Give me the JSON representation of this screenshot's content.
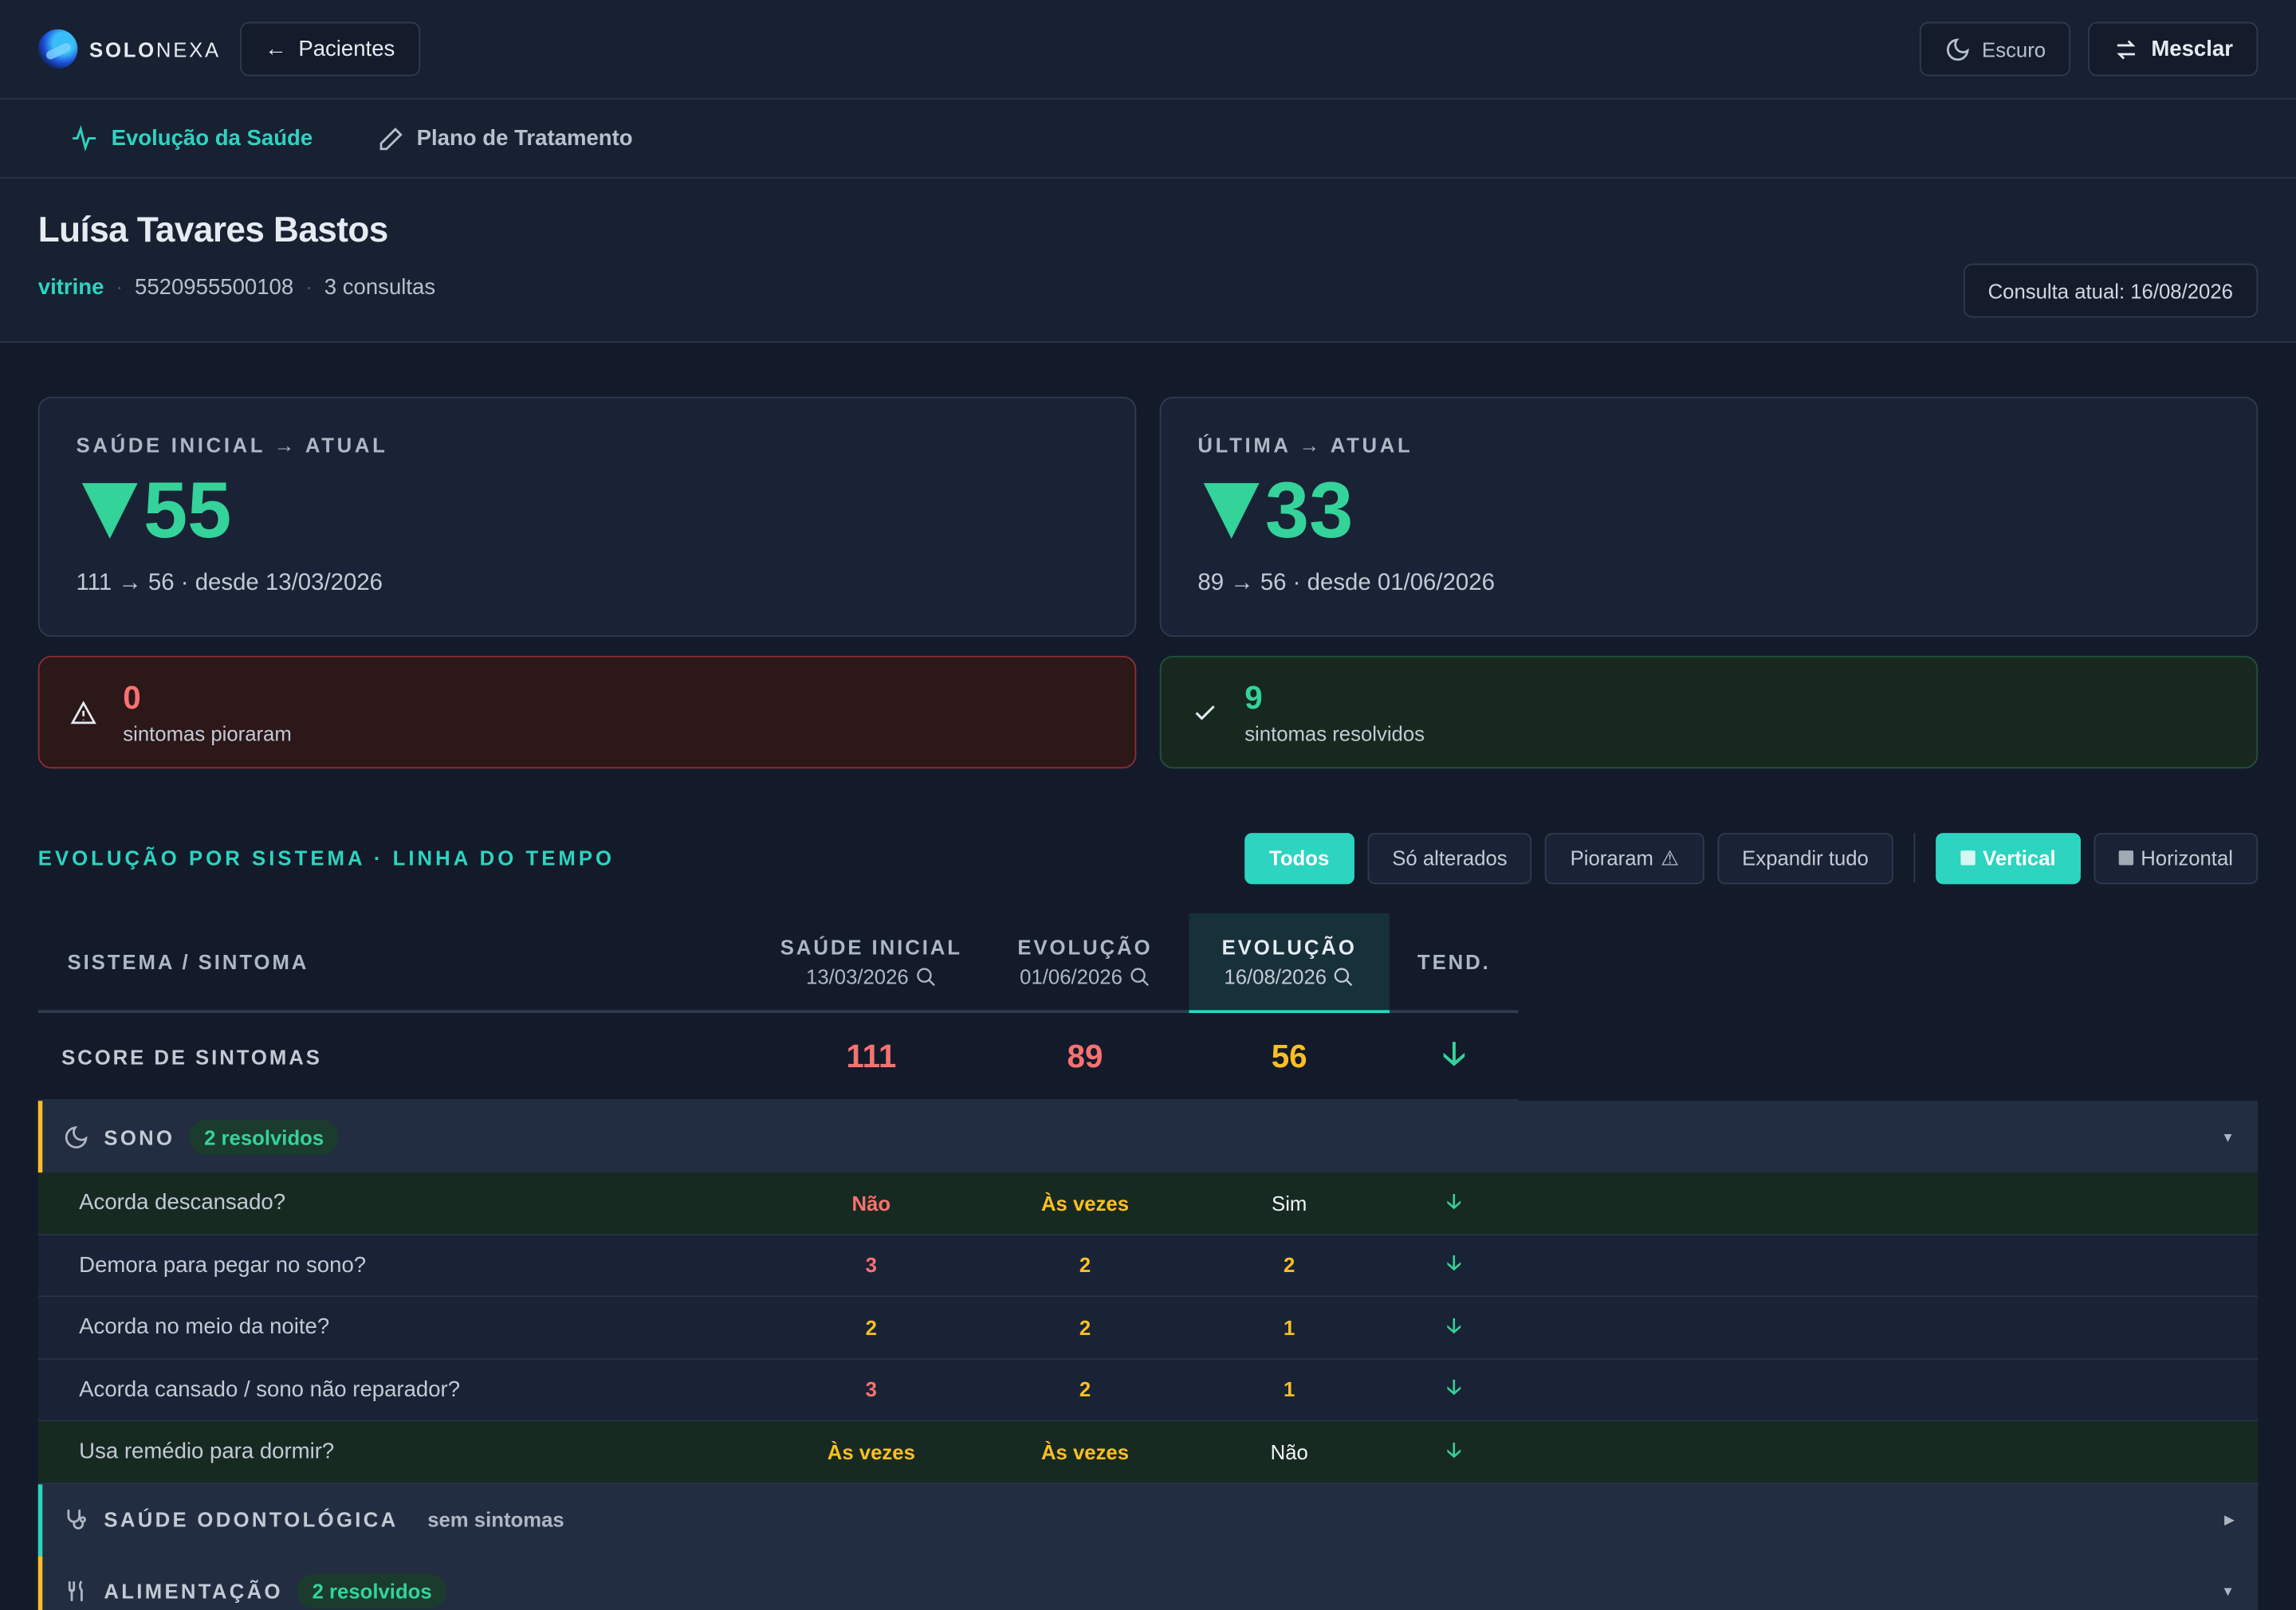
{
  "app": {
    "brand_bold": "SOLO",
    "brand_light": "NEXA",
    "back_label": "Pacientes",
    "theme_label": "Escuro",
    "merge_label": "Mesclar"
  },
  "tabs": [
    {
      "label": "Evolução da Saúde",
      "icon": "pulse-icon",
      "active": true
    },
    {
      "label": "Plano de Tratamento",
      "icon": "pen-icon",
      "active": false
    }
  ],
  "patient": {
    "name": "Luísa Tavares Bastos",
    "tag": "vitrine",
    "phone": "5520955500108",
    "consultations": "3 consultas",
    "current_consult": "Consulta atual: 16/08/2026"
  },
  "cards": [
    {
      "label": "SAÚDE INICIAL → ATUAL",
      "value": "55",
      "sub": "111 → 56 · desde 13/03/2026"
    },
    {
      "label": "ÚLTIMA → ATUAL",
      "value": "33",
      "sub": "89 → 56 · desde 01/06/2026"
    }
  ],
  "alerts": {
    "worse_count": "0",
    "worse_text": "sintomas pioraram",
    "resolved_count": "9",
    "resolved_text": "sintomas resolvidos"
  },
  "section": {
    "title": "EVOLUÇÃO POR SISTEMA · LINHA DO TEMPO"
  },
  "filters": {
    "all": "Todos",
    "changed": "Só alterados",
    "worse": "Pioraram",
    "expand": "Expandir tudo",
    "vertical": "Vertical",
    "horizontal": "Horizontal"
  },
  "table": {
    "headers": {
      "system": "SISTEMA / SINTOMA",
      "c1": "SAÚDE INICIAL",
      "c1_date": "13/03/2026",
      "c2": "EVOLUÇÃO",
      "c2_date": "01/06/2026",
      "c3": "EVOLUÇÃO",
      "c3_date": "16/08/2026",
      "trend": "TEND."
    },
    "score": {
      "label": "SCORE DE SINTOMAS",
      "v1": "111",
      "v2": "89",
      "v3": "56"
    },
    "groups": {
      "sono": {
        "title": "SONO",
        "badge": "2 resolvidos"
      },
      "odonto": {
        "title": "SAÚDE ODONTOLÓGICA",
        "note": "sem sintomas"
      },
      "alimentacao": {
        "title": "ALIMENTAÇÃO",
        "badge": "2 resolvidos"
      }
    },
    "rows": [
      {
        "label": "Acorda descansado?",
        "v1": "Não",
        "v2": "Às vezes",
        "v3": "Sim"
      },
      {
        "label": "Demora para pegar no sono?",
        "v1": "3",
        "v2": "2",
        "v3": "2"
      },
      {
        "label": "Acorda no meio da noite?",
        "v1": "2",
        "v2": "2",
        "v3": "1"
      },
      {
        "label": "Acorda cansado / sono não reparador?",
        "v1": "3",
        "v2": "2",
        "v3": "1"
      },
      {
        "label": "Usa remédio para dormir?",
        "v1": "Às vezes",
        "v2": "Às vezes",
        "v3": "Não"
      }
    ]
  },
  "colors": {
    "accent": "#2dd4bf",
    "good": "#34d399",
    "bad": "#f87171",
    "warn": "#fbbf24"
  }
}
